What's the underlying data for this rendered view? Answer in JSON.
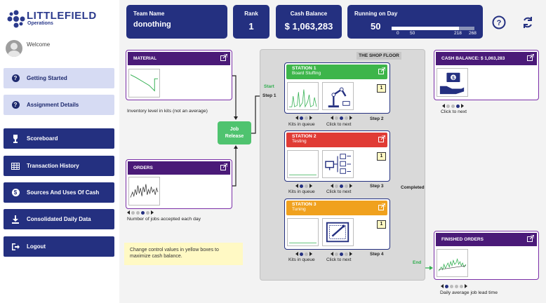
{
  "sidebar": {
    "logo_title": "LITTLEFIELD",
    "logo_subtitle": "Operations",
    "welcome": "Welcome",
    "items": [
      {
        "label": "Getting Started",
        "icon": "question-circle-icon"
      },
      {
        "label": "Assignment Details",
        "icon": "question-circle-icon"
      },
      {
        "label": "Scoreboard",
        "icon": "trophy-icon"
      },
      {
        "label": "Transaction History",
        "icon": "table-icon"
      },
      {
        "label": "Sources And Uses Of Cash",
        "icon": "dollar-circle-icon"
      },
      {
        "label": "Consolidated Daily Data",
        "icon": "download-icon"
      },
      {
        "label": "Logout",
        "icon": "logout-icon"
      }
    ]
  },
  "header": {
    "team_label": "Team Name",
    "team_value": "donothing",
    "rank_label": "Rank",
    "rank_value": "1",
    "cash_label": "Cash Balance",
    "cash_value": "$ 1,063,283",
    "running_label": "Running on Day",
    "running_value": "50",
    "progress_fraction": 0.813,
    "progress_ticks": [
      "0",
      "50",
      "218",
      "268"
    ]
  },
  "material": {
    "title": "MATERIAL",
    "caption": "Inventory level in kits (not an average)"
  },
  "orders": {
    "title": "ORDERS",
    "caption": "Number of jobs accepted each day"
  },
  "cash_card": {
    "title": "CASH BALANCE: $ 1,063,283",
    "caption": "Click to next"
  },
  "finished": {
    "title": "FINISHED ORDERS",
    "caption": "Daily average job lead time"
  },
  "job_release": {
    "line1": "Job",
    "line2": "Release"
  },
  "shop_floor": {
    "title": "THE SHOP FLOOR",
    "start": "Start",
    "end": "End",
    "completed": "Completed",
    "steps": [
      "Step 1",
      "Step 2",
      "Step 3",
      "Step 4"
    ],
    "stations": [
      {
        "title": "STATION 1",
        "subtitle": "Board Stuffing",
        "machines": "1",
        "color": "#3db54a",
        "queue_label": "Kits in queue",
        "next_label": "Click to next"
      },
      {
        "title": "STATION 2",
        "subtitle": "Testing",
        "machines": "1",
        "color": "#e03b35",
        "queue_label": "Kits in queue",
        "next_label": "Click to next"
      },
      {
        "title": "STATION 3",
        "subtitle": "Tuning",
        "machines": "1",
        "color": "#f0a11e",
        "queue_label": "Kits in queue",
        "next_label": "Click to next"
      }
    ]
  },
  "note": "Change control values in yellow boxes to maximize cash balance.",
  "colors": {
    "navy": "#243080",
    "purple": "#4a1a78",
    "green": "#3db54a",
    "red": "#e03b35",
    "orange": "#f0a11e"
  }
}
